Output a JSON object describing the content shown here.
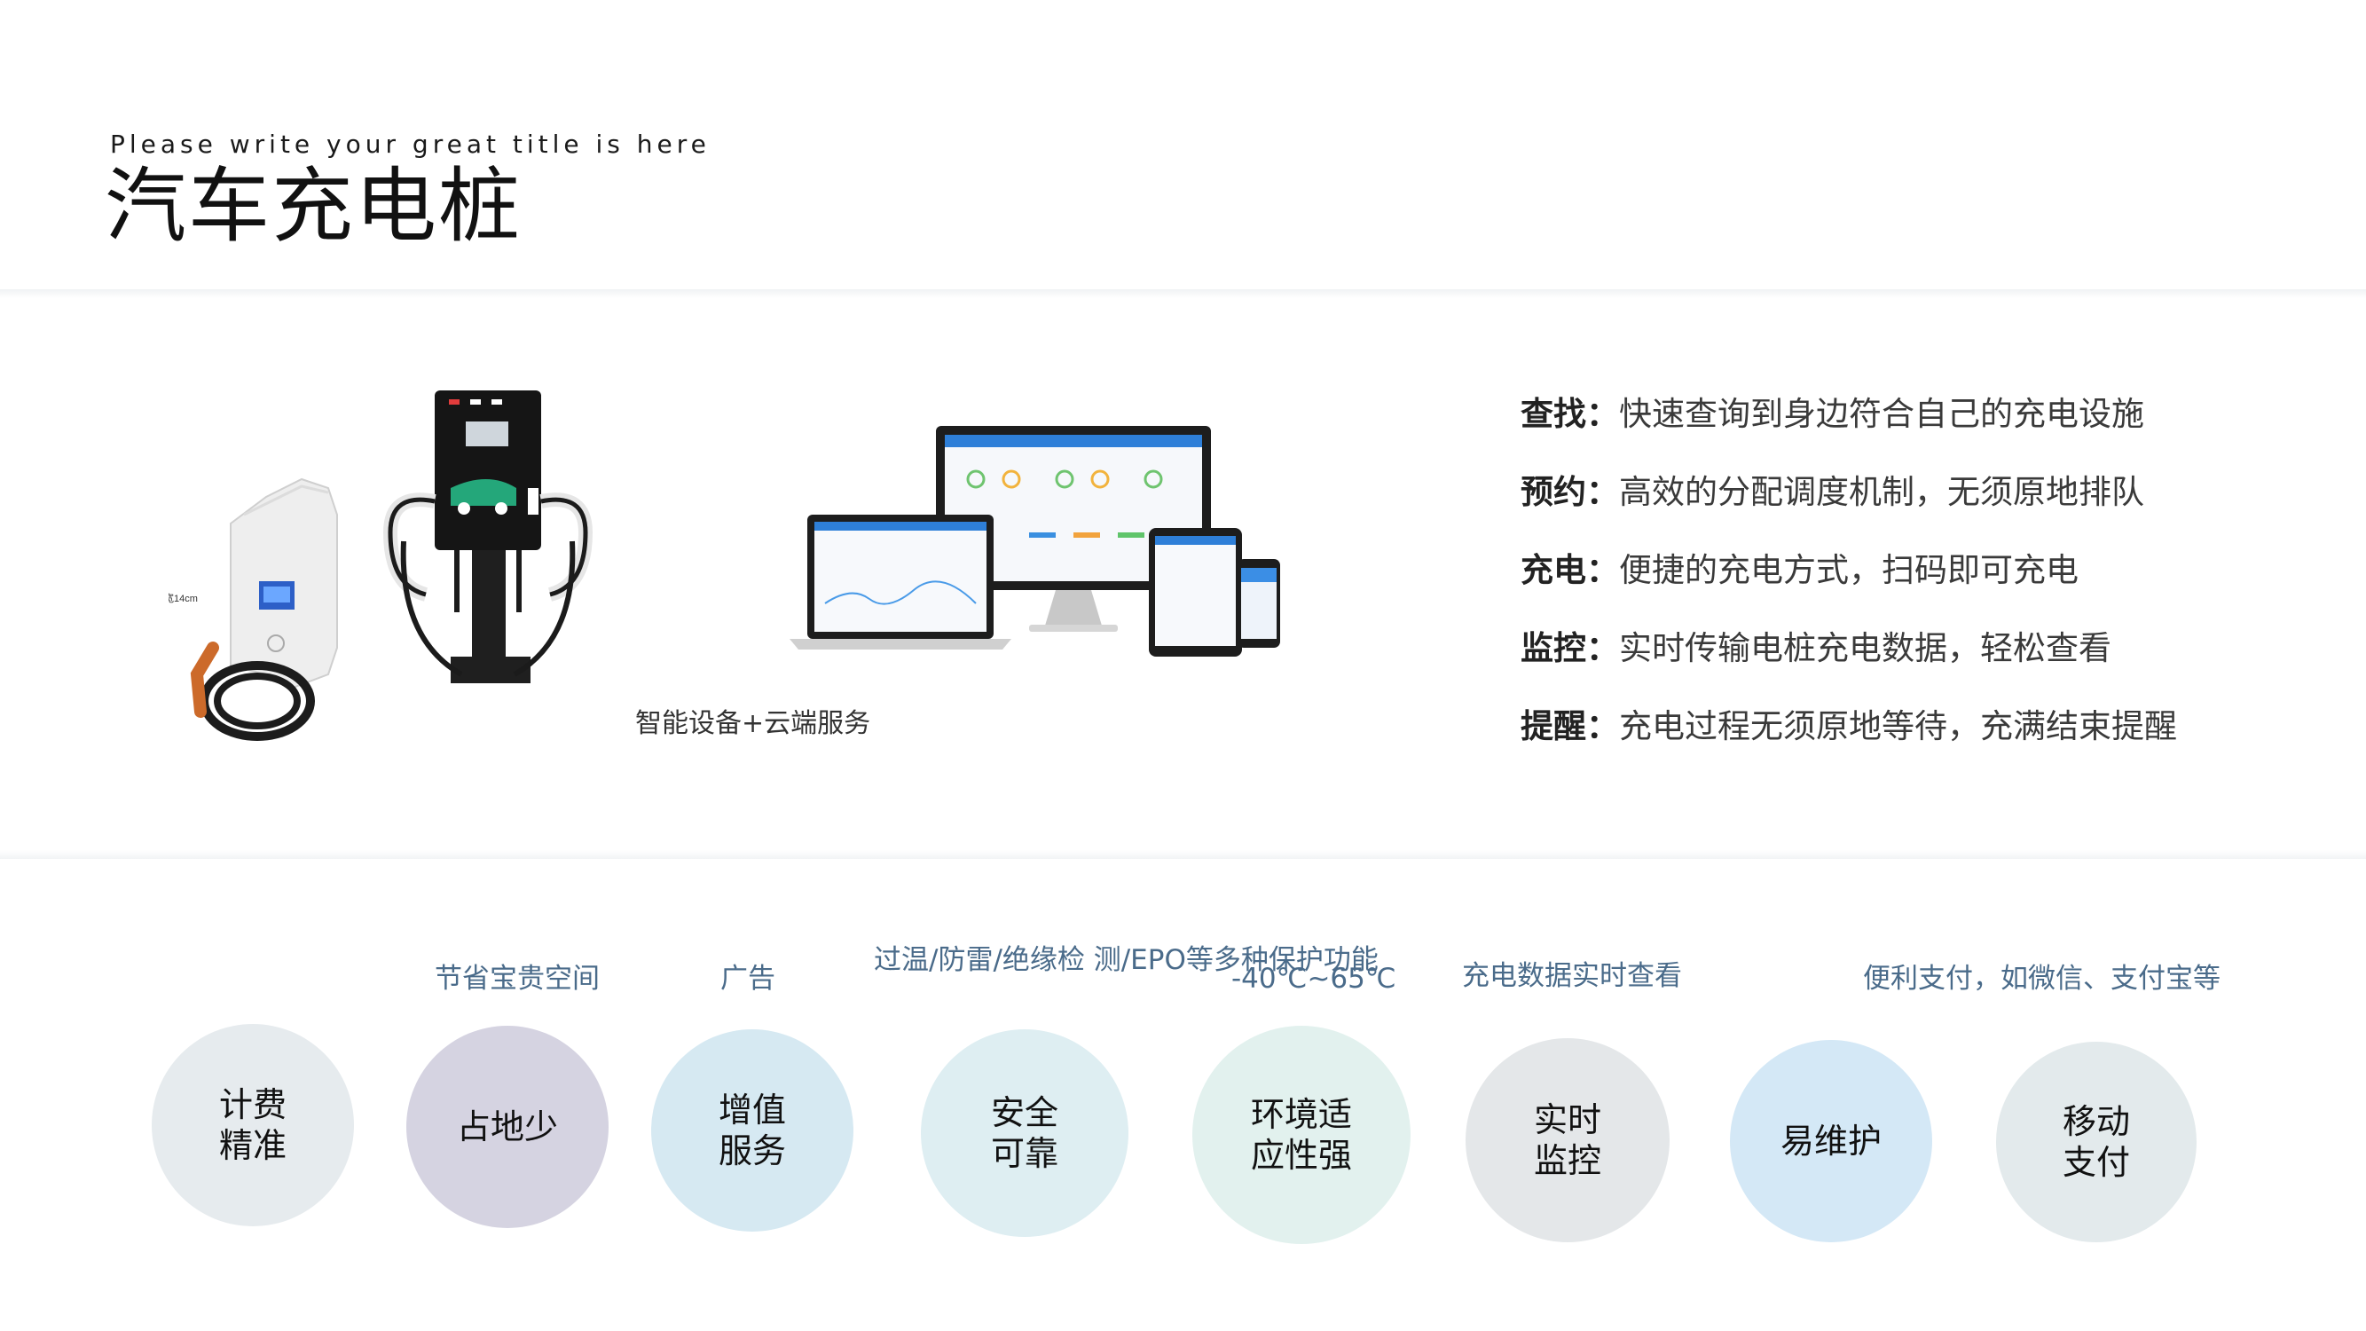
{
  "header": {
    "subtitle": "Please write your great title is here",
    "title": "汽车充电桩"
  },
  "illustration": {
    "caption": "智能设备+云端服务",
    "charger_label": "宽14cm"
  },
  "features": [
    {
      "key": "查找：",
      "text": "快速查询到身边符合自己的充电设施"
    },
    {
      "key": "预约：",
      "text": "高效的分配调度机制，无须原地排队"
    },
    {
      "key": "充电：",
      "text": "便捷的充电方式，扫码即可充电"
    },
    {
      "key": "监控：",
      "text": "实时传输电桩充电数据，轻松查看"
    },
    {
      "key": "提醒：",
      "text": "充电过程无须原地等待，充满结束提醒"
    }
  ],
  "advantages": [
    {
      "label": "计费\n精准",
      "note": "",
      "color": "#e6ebee"
    },
    {
      "label": "占地少",
      "note": "节省宝贵空间",
      "color": "#d5d3e1"
    },
    {
      "label": "增值\n服务",
      "note": "广告",
      "color": "#d6e9f2"
    },
    {
      "label": "安全\n可靠",
      "note": "过温/防雷/绝缘检\n测/EPO等多种保护功能",
      "color": "#deeef2"
    },
    {
      "label": "环境适\n应性强",
      "note": "-40℃~65℃",
      "color": "#e2f1ee"
    },
    {
      "label": "实时\n监控",
      "note": "充电数据实时查看",
      "color": "#e4e7e9"
    },
    {
      "label": "易维护",
      "note": "",
      "color": "#d4e8f6"
    },
    {
      "label": "移动\n支付",
      "note": "便利支付，如微信、支付宝等",
      "color": "#e3eaec"
    }
  ]
}
